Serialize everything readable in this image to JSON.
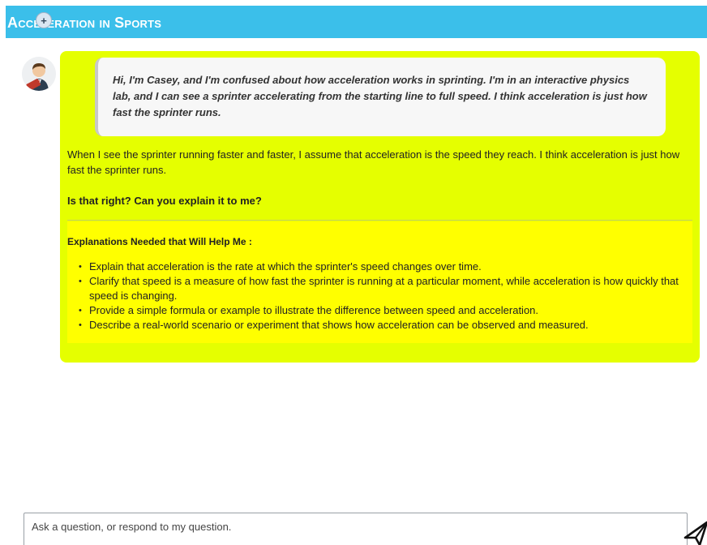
{
  "header": {
    "title": "Acceleration in Sports",
    "add_label": "+"
  },
  "message": {
    "quote": "Hi, I'm Casey, and I'm confused about how acceleration works in sprinting. I'm in an interactive physics lab, and I can see a sprinter accelerating from the starting line to full speed. I think acceleration is just how fast the sprinter runs.",
    "paragraph": "When I see the sprinter running faster and faster, I assume that acceleration is the speed they reach. I think acceleration is just how fast the sprinter runs.",
    "question": "Is that right? Can you explain it to me?",
    "needs_title": "Explanations Needed that Will Help Me :",
    "needs_items": [
      "Explain that acceleration is the rate at which the sprinter's speed changes over time.",
      "Clarify that speed is a measure of how fast the sprinter is running at a particular moment, while acceleration is how quickly that speed is changing.",
      "Provide a simple formula or example to illustrate the difference between speed and acceleration.",
      "Describe a real-world scenario or experiment that shows how acceleration can be observed and measured."
    ]
  },
  "input": {
    "placeholder": "Ask a question, or respond to my question."
  },
  "colors": {
    "header": "#3bbfea",
    "bubble": "#e5ff00",
    "needs_box": "#ffff00"
  },
  "icons": {
    "add": "plus-icon",
    "avatar": "student-avatar-icon",
    "send": "paper-plane-icon"
  }
}
